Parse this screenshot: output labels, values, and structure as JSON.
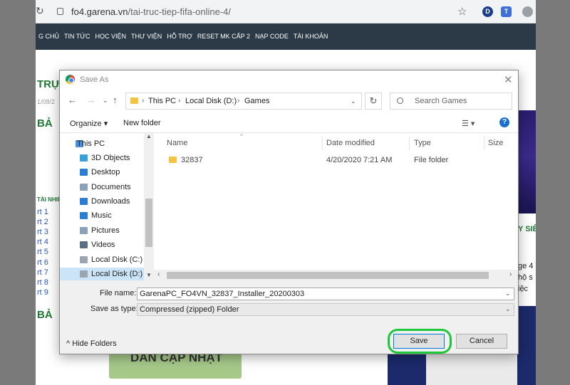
{
  "browser": {
    "url_host": "fo4.garena.vn",
    "url_path": "/tai-truc-tiep-fifa-online-4/",
    "extensions": [
      "D",
      "T"
    ]
  },
  "site_nav": {
    "items": [
      "G CHỦ",
      "TIN TỨC",
      "HỌC VIỆN",
      "THƯ VIỆN",
      "HỖ TRỢ",
      "RESET MK CẤP 2",
      "NẠP CODE",
      "TÀI KHOẢN"
    ]
  },
  "page_bg": {
    "heading_1": "TRỰ",
    "date_fragment": "1/08/2",
    "heading_2": "BẢ",
    "small_label": "TÀI NHIỆ",
    "links": [
      "rt 1",
      "rt 2",
      "rt 3",
      "rt 4",
      "rt 5",
      "rt 6",
      "rt 7",
      "rt 8",
      "rt 9"
    ],
    "heading_3": "BẢ",
    "update_button": "DÁN CẬP NHẬT",
    "right_texts": [
      "Y SIÊ",
      "ge 4 s",
      "hộ s",
      "iệc"
    ]
  },
  "dialog": {
    "title": "Save As",
    "close_glyph": "✕",
    "breadcrumbs": [
      "This PC",
      "Local Disk (D:)",
      "Games"
    ],
    "search_placeholder": "Search Games",
    "organize_label": "Organize ▾",
    "new_folder_label": "New folder",
    "view_glyph": "☰ ▾",
    "help_glyph": "?",
    "nav_items": [
      {
        "label": "This PC",
        "icon": "computer-icon",
        "color": "#4a90d9"
      },
      {
        "label": "3D Objects",
        "icon": "cube-icon",
        "color": "#3aa0d8"
      },
      {
        "label": "Desktop",
        "icon": "desktop-icon",
        "color": "#2a7fd4"
      },
      {
        "label": "Documents",
        "icon": "documents-icon",
        "color": "#8aa1b8"
      },
      {
        "label": "Downloads",
        "icon": "download-icon",
        "color": "#2a7fd4"
      },
      {
        "label": "Music",
        "icon": "music-icon",
        "color": "#2a7fd4"
      },
      {
        "label": "Pictures",
        "icon": "pictures-icon",
        "color": "#8aa1b8"
      },
      {
        "label": "Videos",
        "icon": "videos-icon",
        "color": "#5a6f86"
      },
      {
        "label": "Local Disk (C:)",
        "icon": "drive-icon",
        "color": "#9aa5b1"
      },
      {
        "label": "Local Disk (D:)",
        "icon": "drive-icon",
        "color": "#9aa5b1"
      }
    ],
    "selected_nav": "Local Disk (D:)",
    "columns": [
      "Name",
      "Date modified",
      "Type",
      "Size"
    ],
    "files": [
      {
        "name": "32837",
        "date": "4/20/2020 7:21 AM",
        "type": "File folder",
        "size": ""
      }
    ],
    "file_name_label": "File name:",
    "file_name_value": "GarenaPC_FO4VN_32837_Installer_20200303",
    "save_type_label": "Save as type:",
    "save_type_value": "Compressed (zipped) Folder",
    "hide_folders_label": "Hide Folders",
    "save_label": "Save",
    "cancel_label": "Cancel"
  }
}
